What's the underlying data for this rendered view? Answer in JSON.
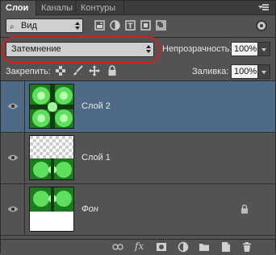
{
  "tabs": [
    {
      "label": "Слои",
      "active": true
    },
    {
      "label": "Каналы",
      "active": false
    },
    {
      "label": "Контуры",
      "active": false
    }
  ],
  "tab_close": "×",
  "filter": {
    "kind_label": "Вид",
    "icon": "magnifier-icon"
  },
  "blend_mode": {
    "value": "Затемнение"
  },
  "opacity": {
    "label": "Непрозрачность:",
    "value": "100%"
  },
  "lock": {
    "label": "Закрепить:"
  },
  "fill": {
    "label": "Заливка:",
    "value": "100%"
  },
  "layers": [
    {
      "name": "Слой 2",
      "selected": true,
      "thumbnail": "green-kaleidoscope",
      "locked": false,
      "italic": false
    },
    {
      "name": "Слой 1",
      "selected": false,
      "thumbnail": "checker-top-green-bottom",
      "locked": false,
      "italic": false
    },
    {
      "name": "Фон",
      "selected": false,
      "thumbnail": "green-top-white-bottom",
      "locked": true,
      "italic": true
    }
  ],
  "bottom_toolbar": {
    "fx_label": "fx"
  },
  "colors": {
    "panel_bg": "#535353",
    "selected_row": "#4f6a87",
    "highlight": "#d41e1e"
  }
}
